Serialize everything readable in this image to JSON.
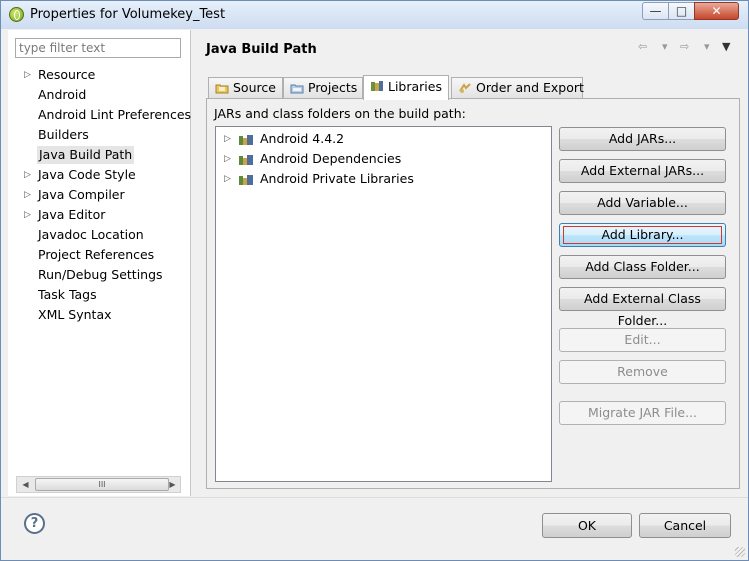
{
  "window": {
    "title": "Properties for Volumekey_Test",
    "controls": {
      "minimize": "—",
      "maximize": "□",
      "close": "✕"
    }
  },
  "left_pane": {
    "filter_placeholder": "type filter text",
    "items": [
      {
        "label": "Resource",
        "expandable": true,
        "selected": false
      },
      {
        "label": "Android",
        "expandable": false,
        "selected": false
      },
      {
        "label": "Android Lint Preferences",
        "expandable": false,
        "selected": false
      },
      {
        "label": "Builders",
        "expandable": false,
        "selected": false
      },
      {
        "label": "Java Build Path",
        "expandable": false,
        "selected": true
      },
      {
        "label": "Java Code Style",
        "expandable": true,
        "selected": false
      },
      {
        "label": "Java Compiler",
        "expandable": true,
        "selected": false
      },
      {
        "label": "Java Editor",
        "expandable": true,
        "selected": false
      },
      {
        "label": "Javadoc Location",
        "expandable": false,
        "selected": false
      },
      {
        "label": "Project References",
        "expandable": false,
        "selected": false
      },
      {
        "label": "Run/Debug Settings",
        "expandable": false,
        "selected": false
      },
      {
        "label": "Task Tags",
        "expandable": false,
        "selected": false
      },
      {
        "label": "XML Syntax",
        "expandable": false,
        "selected": false
      }
    ],
    "scroll_thumb_grip": "III"
  },
  "page": {
    "title": "Java Build Path",
    "nav": {
      "back": "⇦",
      "back_menu": "▾",
      "forward": "⇨",
      "forward_menu": "▾",
      "view_menu": "▼"
    }
  },
  "tabs": [
    {
      "label": "Source",
      "icon": "source-folder-icon",
      "active": false
    },
    {
      "label": "Projects",
      "icon": "projects-icon",
      "active": false
    },
    {
      "label": "Libraries",
      "icon": "libraries-icon",
      "active": true
    },
    {
      "label": "Order and Export",
      "icon": "order-export-icon",
      "active": false
    }
  ],
  "libraries": {
    "label": "JARs and class folders on the build path:",
    "entries": [
      {
        "label": "Android 4.4.2",
        "icon": "library-jar-icon"
      },
      {
        "label": "Android Dependencies",
        "icon": "library-jar-icon"
      },
      {
        "label": "Android Private Libraries",
        "icon": "library-jar-icon"
      }
    ],
    "expander": "▷"
  },
  "buttons": {
    "add_jars": "Add JARs...",
    "add_external_jars": "Add External JARs...",
    "add_variable": "Add Variable...",
    "add_library": "Add Library...",
    "add_class_folder": "Add Class Folder...",
    "add_external_class_folder": "Add External Class Folder...",
    "edit": "Edit...",
    "remove": "Remove",
    "migrate_jar": "Migrate JAR File..."
  },
  "footer": {
    "help": "?",
    "ok": "OK",
    "cancel": "Cancel"
  },
  "colors": {
    "focus_button": "#bee6fd",
    "focus_ring": "#d4372c",
    "close_button": "#c7462b"
  }
}
